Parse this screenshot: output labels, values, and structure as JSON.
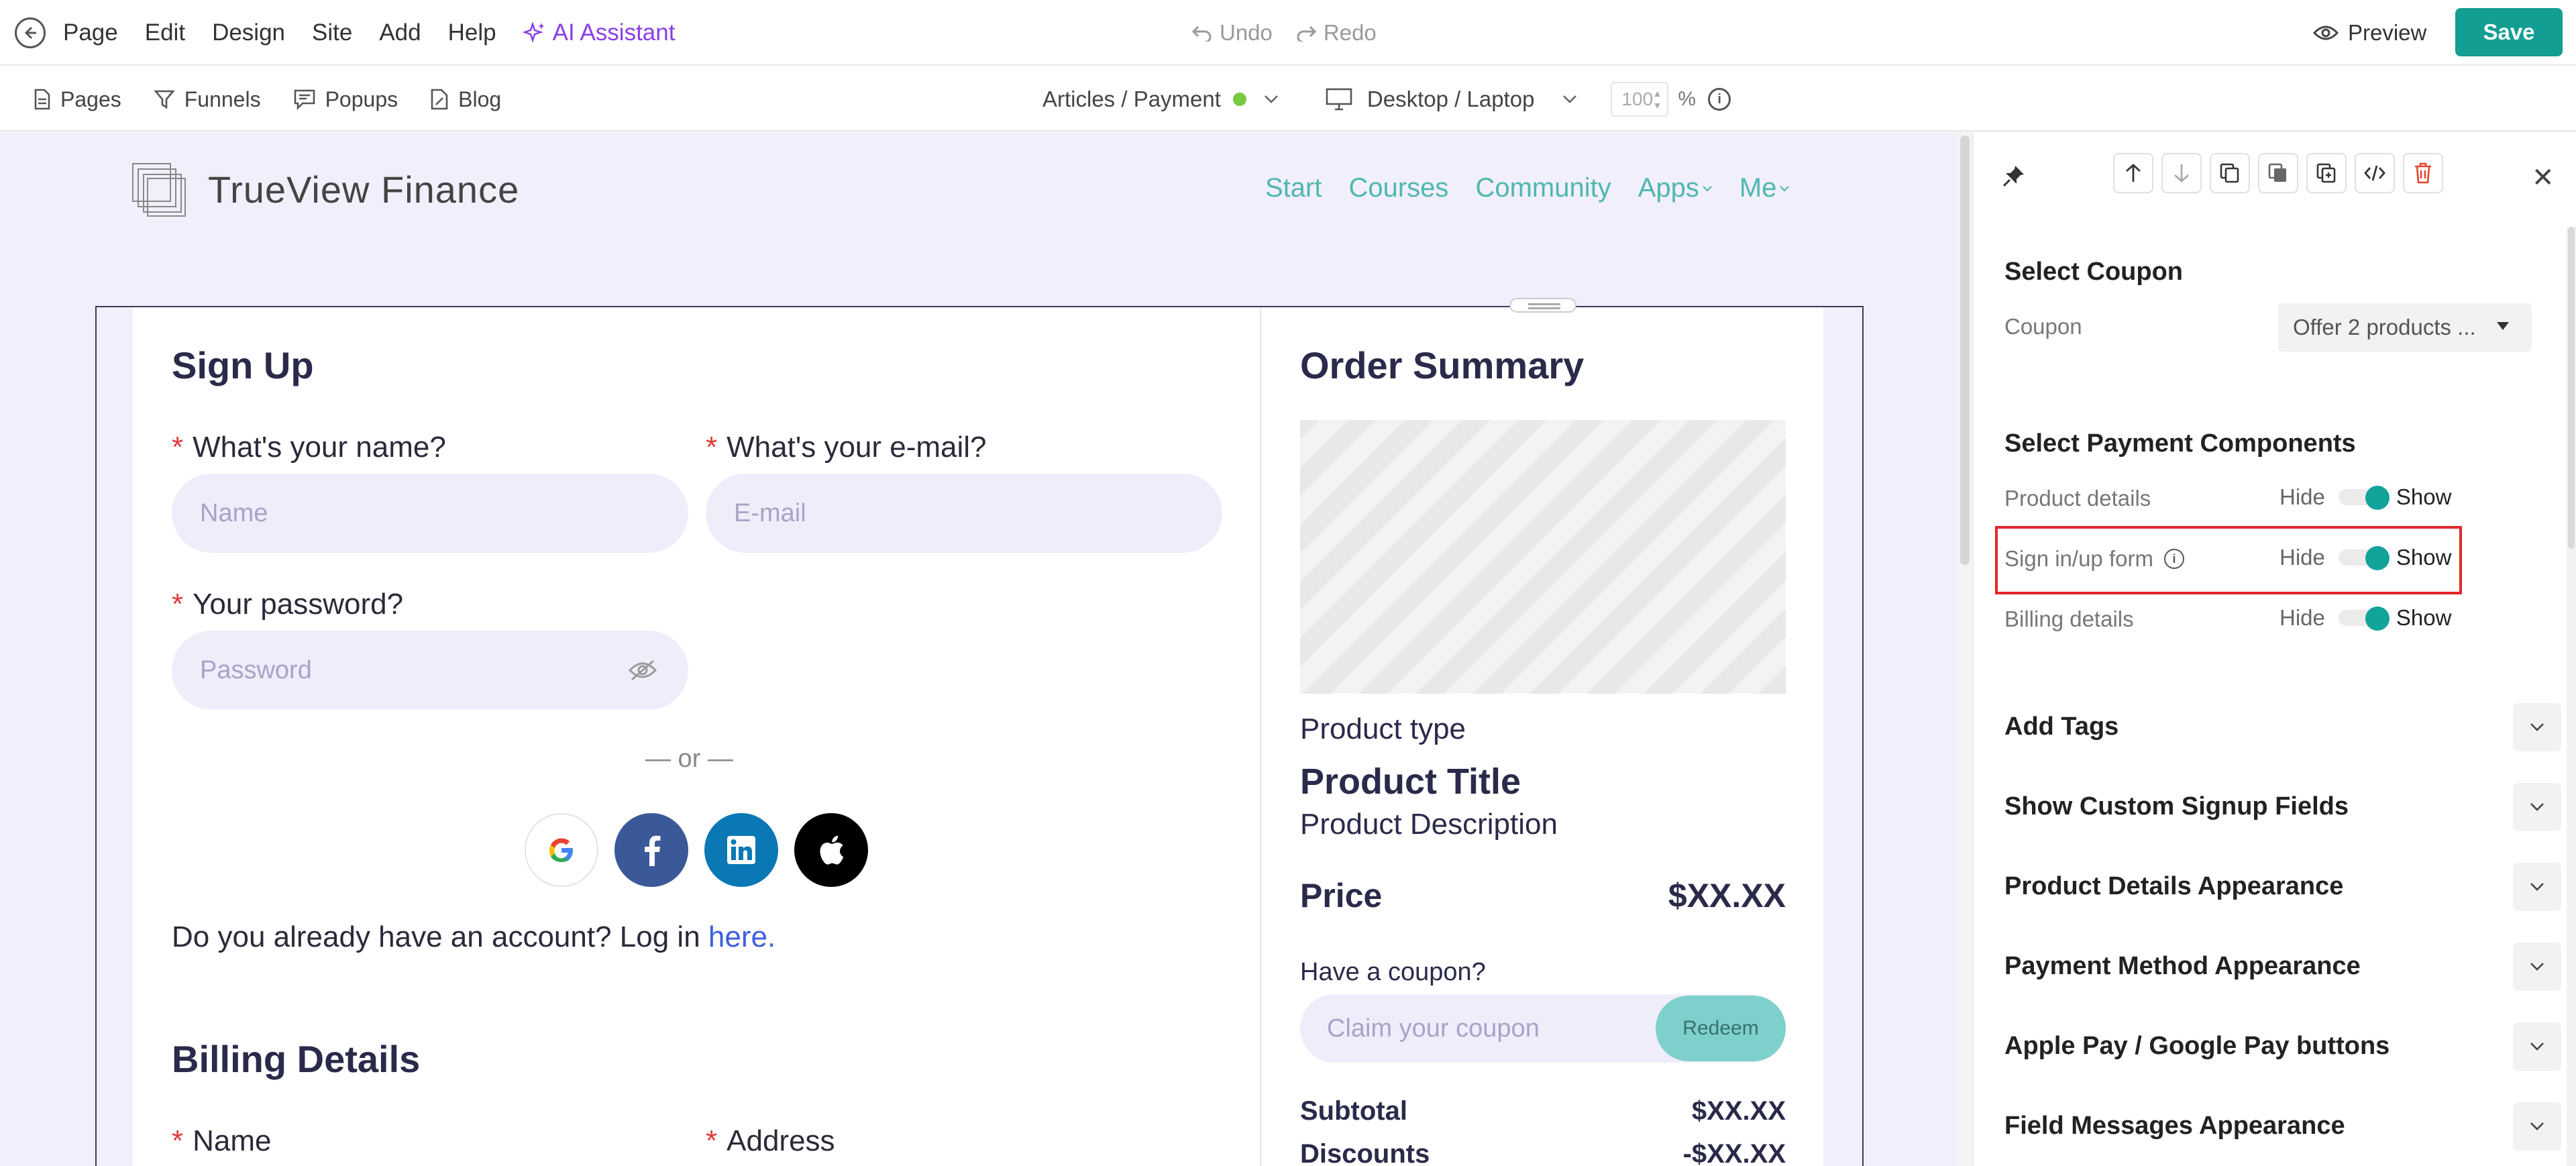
{
  "topbar": {
    "menu": [
      "Page",
      "Edit",
      "Design",
      "Site",
      "Add",
      "Help"
    ],
    "ai_assistant": "AI Assistant",
    "undo": "Undo",
    "redo": "Redo",
    "preview": "Preview",
    "save": "Save"
  },
  "toolbar": {
    "pages": "Pages",
    "funnels": "Funnels",
    "popups": "Popups",
    "blog": "Blog",
    "breadcrumb": "Articles / Payment",
    "device": "Desktop / Laptop",
    "zoom": "100",
    "zoom_unit": "%"
  },
  "site": {
    "brand": "TrueView Finance",
    "nav": [
      "Start",
      "Courses",
      "Community",
      "Apps",
      "Me"
    ]
  },
  "signup": {
    "title": "Sign Up",
    "name_label": "What's your name?",
    "name_placeholder": "Name",
    "email_label": "What's your e-mail?",
    "email_placeholder": "E-mail",
    "password_label": "Your password?",
    "password_placeholder": "Password",
    "or": "— or —",
    "login_text": "Do you already have an account? Log in",
    "login_link": "here."
  },
  "billing": {
    "title": "Billing Details",
    "name_label": "Name",
    "address_label": "Address"
  },
  "order": {
    "title": "Order Summary",
    "product_type": "Product type",
    "product_title": "Product Title",
    "product_description": "Product Description",
    "price_label": "Price",
    "price_value": "$XX.XX",
    "coupon_question": "Have a coupon?",
    "coupon_placeholder": "Claim your coupon",
    "redeem": "Redeem",
    "subtotal_label": "Subtotal",
    "subtotal_value": "$XX.XX",
    "discounts_label": "Discounts",
    "discounts_value": "-$XX.XX"
  },
  "panel": {
    "select_coupon": "Select Coupon",
    "coupon_label": "Coupon",
    "coupon_value": "Offer 2 products ...",
    "select_components": "Select Payment Components",
    "hide": "Hide",
    "show": "Show",
    "components": [
      "Product details",
      "Sign in/up form",
      "Billing details"
    ],
    "sections": [
      "Add Tags",
      "Show Custom Signup Fields",
      "Product Details Appearance",
      "Payment Method Appearance",
      "Apple Pay / Google Pay buttons",
      "Field Messages Appearance"
    ]
  },
  "colors": {
    "accent": "#129e92",
    "ai": "#8b3ee6",
    "nav": "#4fb7b0",
    "canvas_bg": "#f1effb",
    "highlight": "#e3262b"
  }
}
